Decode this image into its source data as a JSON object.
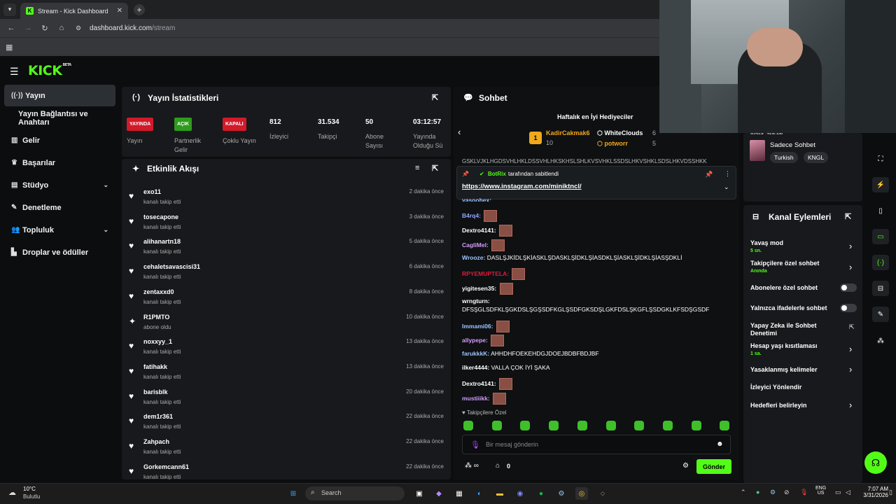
{
  "browser": {
    "tab_title": "Stream - Kick Dashboard",
    "url_host": "dashboard.kick.com",
    "url_path": "/stream"
  },
  "logo": "KICK",
  "logo_tag": "BETA",
  "sidebar": {
    "items": [
      {
        "label": "Yayın",
        "icon": "broadcast-icon",
        "active": true
      },
      {
        "label": "Yayın Bağlantısı ve Anahtarı",
        "icon": "",
        "active": false
      },
      {
        "label": "Gelir",
        "icon": "chart-icon",
        "active": false
      },
      {
        "label": "Başarılar",
        "icon": "trophy-icon",
        "active": false
      },
      {
        "label": "Stüdyo",
        "icon": "studio-icon",
        "active": false
      },
      {
        "label": "Denetleme",
        "icon": "wrench-icon",
        "active": false
      },
      {
        "label": "Topluluk",
        "icon": "people-icon",
        "active": false
      },
      {
        "label": "Droplar ve ödüller",
        "icon": "drops-icon",
        "active": false
      }
    ]
  },
  "stats": {
    "title": "Yayın İstatistikleri",
    "items": [
      {
        "badge": "YAYINDA",
        "badge_color": "#d11a2a",
        "label": "Yayın"
      },
      {
        "badge": "AÇIK",
        "badge_color": "#2e9b1c",
        "label": "Partnerlik Gelir"
      },
      {
        "badge": "KAPALI",
        "badge_color": "#d11a2a",
        "label": "Çoklu Yayın"
      },
      {
        "value": "812",
        "label": "İzleyici"
      },
      {
        "value": "31.534",
        "label": "Takipçi"
      },
      {
        "value": "50",
        "label": "Abone Sayısı"
      },
      {
        "value": "03:12:57",
        "label": "Yayında Olduğu Sü"
      }
    ]
  },
  "events": {
    "title": "Etkinlik Akışı",
    "items": [
      {
        "name": "exo11",
        "desc": "kanalı takip etti",
        "time": "2 dakika önce",
        "icon": "heart-icon"
      },
      {
        "name": "tosecapone",
        "desc": "kanalı takip etti",
        "time": "3 dakika önce",
        "icon": "heart-icon"
      },
      {
        "name": "alihanartn18",
        "desc": "kanalı takip etti",
        "time": "5 dakika önce",
        "icon": "heart-icon"
      },
      {
        "name": "cehaletsavascisi31",
        "desc": "kanalı takip etti",
        "time": "6 dakika önce",
        "icon": "heart-icon"
      },
      {
        "name": "zentaxxd0",
        "desc": "kanalı takip etti",
        "time": "8 dakika önce",
        "icon": "heart-icon"
      },
      {
        "name": "R1PMTO",
        "desc": "abone oldu",
        "time": "10 dakika önce",
        "icon": "sparkle-icon"
      },
      {
        "name": "noxxyy_1",
        "desc": "kanalı takip etti",
        "time": "13 dakika önce",
        "icon": "heart-icon"
      },
      {
        "name": "fatihakk",
        "desc": "kanalı takip etti",
        "time": "13 dakika önce",
        "icon": "heart-icon"
      },
      {
        "name": "barisblk",
        "desc": "kanalı takip etti",
        "time": "20 dakika önce",
        "icon": "heart-icon"
      },
      {
        "name": "dem1r361",
        "desc": "kanalı takip etti",
        "time": "22 dakika önce",
        "icon": "heart-icon"
      },
      {
        "name": "Zahpach",
        "desc": "kanalı takip etti",
        "time": "22 dakika önce",
        "icon": "heart-icon"
      },
      {
        "name": "Gorkemcann61",
        "desc": "kanalı takip etti",
        "time": "22 dakika önce",
        "icon": "heart-icon"
      }
    ]
  },
  "chat": {
    "title": "Sohbet",
    "gifters_title": "Haftalık en İyi Hediyeciler",
    "gifters": [
      {
        "rank": "1",
        "name": "KadirCakmak6",
        "count": "10"
      },
      {
        "name": "WhiteClouds",
        "count": "6"
      },
      {
        "name": "potworr",
        "count": "5"
      }
    ],
    "pinned_by": "BotRix",
    "pinned_suffix": "tarafından sabitlendi",
    "pinned_link": "https://www.instagram.com/miniktncl/",
    "messages": [
      {
        "user": "B4rq4:",
        "color": "#8fa8ff",
        "text": "",
        "emote": true
      },
      {
        "user": "Dextro4141:",
        "color": "#ffffff",
        "text": "",
        "emote": true
      },
      {
        "user": "CagliMel:",
        "color": "#d59bff",
        "text": "",
        "emote": true
      },
      {
        "user": "Wrooze:",
        "color": "#9ec6ff",
        "text": "DASLŞJKİDLŞKİASKLŞDASKLŞİDKLŞİASDKLŞİASKLŞİDKLŞİASŞDKLİ",
        "emote": false
      },
      {
        "user": "RPYEMUPTELA:",
        "color": "#e01a3c",
        "text": "",
        "emote": true
      },
      {
        "user": "yigitesen35:",
        "color": "#ffffff",
        "text": "",
        "emote": true
      },
      {
        "user": "Immami06:",
        "color": "#9ec6ff",
        "text": "",
        "emote": true
      },
      {
        "user": "allypepe:",
        "color": "#d59bff",
        "text": "",
        "emote": true
      },
      {
        "user": "farukkkK:",
        "color": "#9ec6ff",
        "text": "AHHDHFOEKEHDGJDOEJBDBFBDJBF",
        "emote": false
      },
      {
        "user": "ilker4444:",
        "color": "#ffffff",
        "text": "VALLA ÇOK İYİ ŞAKA",
        "emote": false
      },
      {
        "user": "Dextro4141:",
        "color": "#ffffff",
        "text": "",
        "emote": true
      },
      {
        "user": "mustiiikk:",
        "color": "#d59bff",
        "text": "",
        "emote": true
      }
    ],
    "wrng_user": "wrngturn:",
    "wrng_text": "DFSŞGLSDFKLŞGKDSLŞGŞSDFKGLŞSDFGKSDŞLGKFDSLŞKGFLŞSDGKLKFSDŞGSDF",
    "top_clip": "GSKLVJKLHGDSVHLHKLDSSVHLHKSKHSLSHLKVSVHKLSSDSLHKVSHKLSDSLHKVDSSHKK",
    "top_clip2": "yasoohex:",
    "followers_only": "Takipçilere Özel",
    "input_placeholder": "Bir mesaj gönderin",
    "points": "0",
    "send_label": "Gönder"
  },
  "channel": {
    "partial_label": "insta :social",
    "mode_title": "Sadece Sohbet",
    "tags": [
      "Turkish",
      "KNGL"
    ]
  },
  "actions": {
    "title": "Kanal Eylemleri",
    "items": [
      {
        "label": "Yavaş mod",
        "sub": "5 sn.",
        "control": "arrow"
      },
      {
        "label": "Takipçilere özel sohbet",
        "sub": "Anında",
        "control": "arrow"
      },
      {
        "label": "Abonelere özel sohbet",
        "sub": "",
        "control": "toggle"
      },
      {
        "label": "Yalnızca ifadelerle sohbet",
        "sub": "",
        "control": "toggle"
      },
      {
        "label": "Yapay Zeka ile Sohbet Denetimi",
        "sub": "",
        "control": "external"
      },
      {
        "label": "Hesap yaşı kısıtlaması",
        "sub": "1 sa.",
        "control": "arrow"
      },
      {
        "label": "Yasaklanmış kelimeler",
        "sub": "",
        "control": "arrow"
      },
      {
        "label": "İzleyici Yönlendir",
        "sub": "",
        "control": "none"
      },
      {
        "label": "Hedefleri belirleyin",
        "sub": "",
        "control": "arrow"
      }
    ]
  },
  "taskbar": {
    "weather_temp": "10°C",
    "weather_desc": "Bulutlu",
    "search": "Search",
    "lang1": "ENG",
    "lang2": "US",
    "time": "7:07 AM",
    "date": "3/31/2026"
  },
  "colors": {
    "accent": "#53fc18",
    "live": "#d11a2a"
  }
}
